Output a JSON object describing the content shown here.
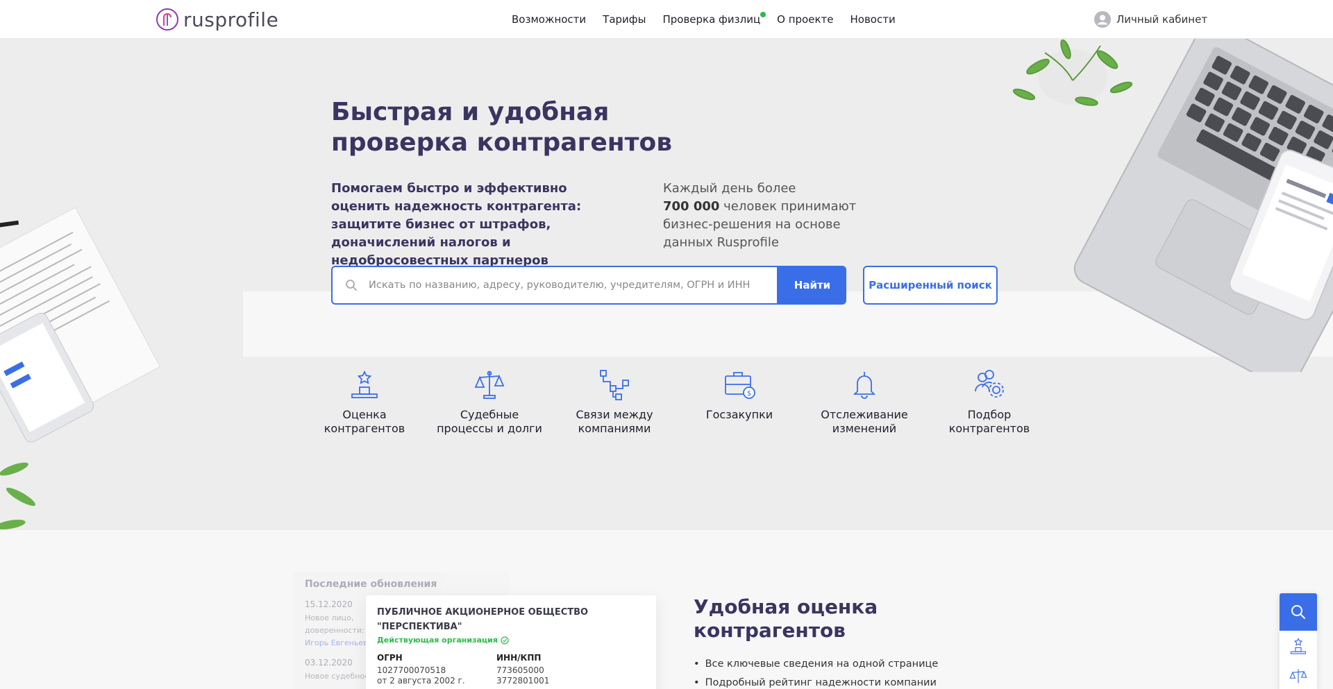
{
  "header": {
    "logo_text": "rusprofile",
    "nav": [
      {
        "label": "Возможности"
      },
      {
        "label": "Тарифы"
      },
      {
        "label": "Проверка физлиц"
      },
      {
        "label": "О проекте"
      },
      {
        "label": "Новости"
      }
    ],
    "cabinet_label": "Личный кабинет"
  },
  "hero": {
    "title": "Быстрая и удобная проверка контрагентов",
    "left_text": "Помогаем быстро и эффективно оценить надежность контрагента: защитите бизнес от штрафов, доначислений налогов и недобросовестных партнеров",
    "right_prefix": "Каждый день более",
    "right_count": "700 000",
    "right_suffix": "человек принимают бизнес-решения на основе данных Rusprofile",
    "search_placeholder": "Искать по названию, адресу, руководителю, учредителям, ОГРН и ИНН",
    "search_button": "Найти",
    "advanced_button": "Расширенный поиск"
  },
  "features": [
    {
      "label": "Оценка контрагентов",
      "icon": "rating-icon"
    },
    {
      "label": "Судебные процессы и долги",
      "icon": "scales-icon"
    },
    {
      "label": "Связи между компаниями",
      "icon": "network-icon"
    },
    {
      "label": "Госзакупки",
      "icon": "briefcase-icon"
    },
    {
      "label": "Отслеживание изменений",
      "icon": "bell-icon"
    },
    {
      "label": "Подбор контрагентов",
      "icon": "users-gear-icon"
    }
  ],
  "updates": {
    "title": "Последние обновления",
    "items": [
      {
        "date": "15.12.2020",
        "text": "Новое лицо, доверенности:",
        "link": "Игорь Евгеньев"
      },
      {
        "date": "03.12.2020",
        "text": "Новое судебное"
      }
    ]
  },
  "company": {
    "name": "ПУБЛИЧНОЕ АКЦИОНЕРНОЕ ОБЩЕСТВО \"ПЕРСПЕКТИВА\"",
    "status": "Действующая организация",
    "ogrn_label": "ОГРН",
    "ogrn_value": "1027700070518",
    "ogrn_date": "от 2 августа 2002 г.",
    "inn_label": "ИНН/КПП",
    "inn_value": "773605000",
    "kpp_value": "3772801001"
  },
  "lower": {
    "title": "Удобная оценка контрагентов",
    "list": [
      "Все ключевые сведения на одной странице",
      "Подробный рейтинг надежности компании"
    ]
  },
  "colors": {
    "accent": "#3a6ee8",
    "title": "#3a3560",
    "status_green": "#2cbb4a",
    "background": "#ededee"
  }
}
